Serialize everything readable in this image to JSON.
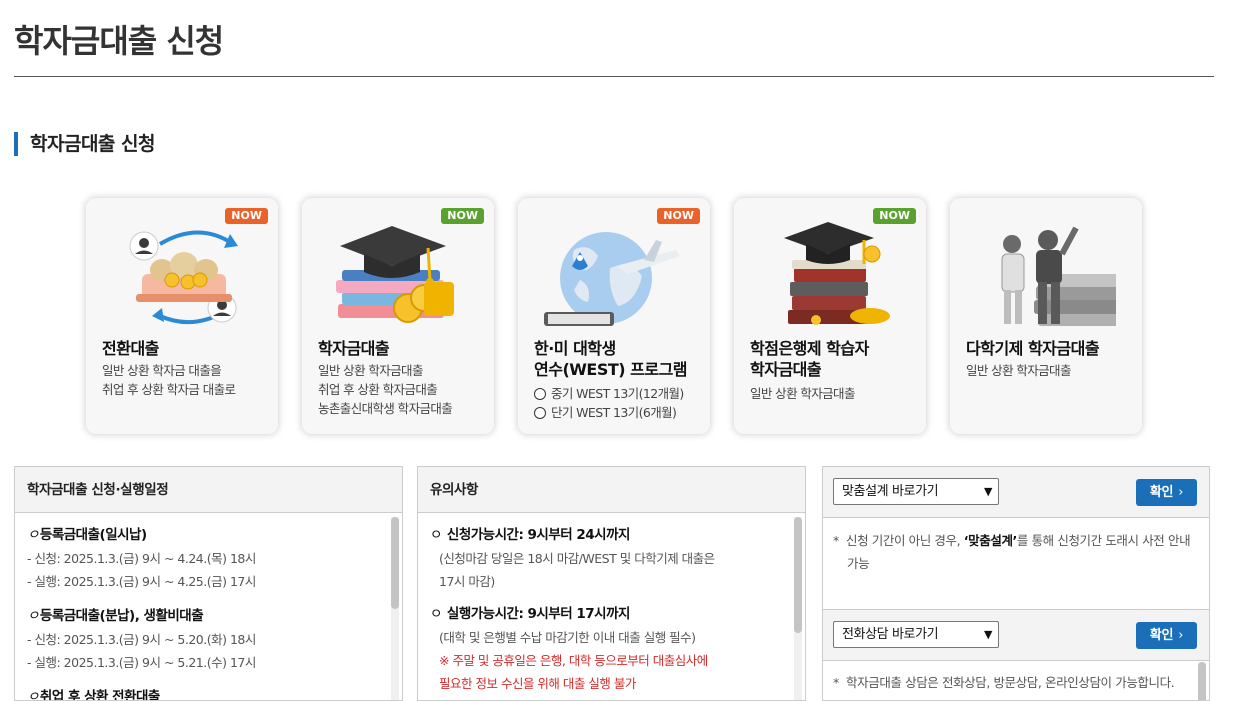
{
  "page": {
    "title": "학자금대출 신청"
  },
  "section": {
    "title": "학자금대출 신청"
  },
  "cards": [
    {
      "title": "전환대출",
      "badge": "NOW",
      "badge_color": "#e8622a",
      "desc": [
        "일반 상환 학자금 대출을",
        "취업 후 상환 학자금 대출로"
      ]
    },
    {
      "title": "학자금대출",
      "badge": "NOW",
      "badge_color": "#5aa130",
      "desc": [
        "일반 상환 학자금대출",
        "취업 후 상환 학자금대출",
        "농촌출신대학생 학자금대출"
      ]
    },
    {
      "title_line1": "한·미 대학생",
      "title_line2": "연수(WEST) 프로그램",
      "badge": "NOW",
      "badge_color": "#e8622a",
      "options": [
        "중기 WEST 13기(12개월)",
        "단기 WEST 13기(6개월)"
      ]
    },
    {
      "title_line1": "학점은행제 학습자",
      "title_line2": "학자금대출",
      "badge": "NOW",
      "badge_color": "#5aa130",
      "desc": [
        "일반 상환 학자금대출"
      ]
    },
    {
      "title": "다학기제 학자금대출",
      "desc": [
        "일반 상환 학자금대출"
      ]
    }
  ],
  "schedule": {
    "title": "학자금대출 신청·실행일정",
    "groups": [
      {
        "marker": "ㅇ",
        "heading": "등록금대출(일시납)",
        "lines": [
          "- 신청: 2025.1.3.(금) 9시 ~ 4.24.(목) 18시",
          "- 실행: 2025.1.3.(금) 9시 ~ 4.25.(금) 17시"
        ]
      },
      {
        "marker": "ㅇ",
        "heading": "등록금대출(분납), 생활비대출",
        "lines": [
          "- 신청: 2025.1.3.(금) 9시 ~ 5.20.(화) 18시",
          "- 실행: 2025.1.3.(금) 9시 ~ 5.21.(수) 17시"
        ]
      },
      {
        "marker": "ㅇ",
        "heading": "취업 후 상환 전환대출",
        "lines": []
      }
    ]
  },
  "notes": {
    "title": "유의사항",
    "groups": [
      {
        "marker": "ㅇ",
        "heading": "신청가능시간: 9시부터 24시까지",
        "lines": [
          "(신청마감 당일은 18시 마감/WEST 및 다학기제 대출은",
          "17시 마감)"
        ],
        "red": []
      },
      {
        "marker": "ㅇ",
        "heading": "실행가능시간: 9시부터 17시까지",
        "lines": [
          "(대학 및 은행별 수납 마감기한 이내 대출 실행 필수)"
        ],
        "red": [
          "※ 주말 및 공휴일은 은행, 대학 등으로부터 대출심사에",
          "필요한 정보 수신을 위해 대출 실행 불가"
        ]
      }
    ]
  },
  "shortcut1": {
    "select_value": "맞춤설계 바로가기",
    "button": "확인",
    "text_before": "신청 기간이 아닌 경우, ",
    "text_bold": "‘맞춤설계’",
    "text_after": "를 통해 신청기간 도래시 사전 안내 가능"
  },
  "shortcut2": {
    "select_value": "전화상담 바로가기",
    "button": "확인",
    "text": "학자금대출 상담은 전화상담, 방문상담, 온라인상담이 가능합니다."
  },
  "icons": {
    "chevron": "›",
    "bullet": "*",
    "dropdown": "chevron-down-icon"
  }
}
